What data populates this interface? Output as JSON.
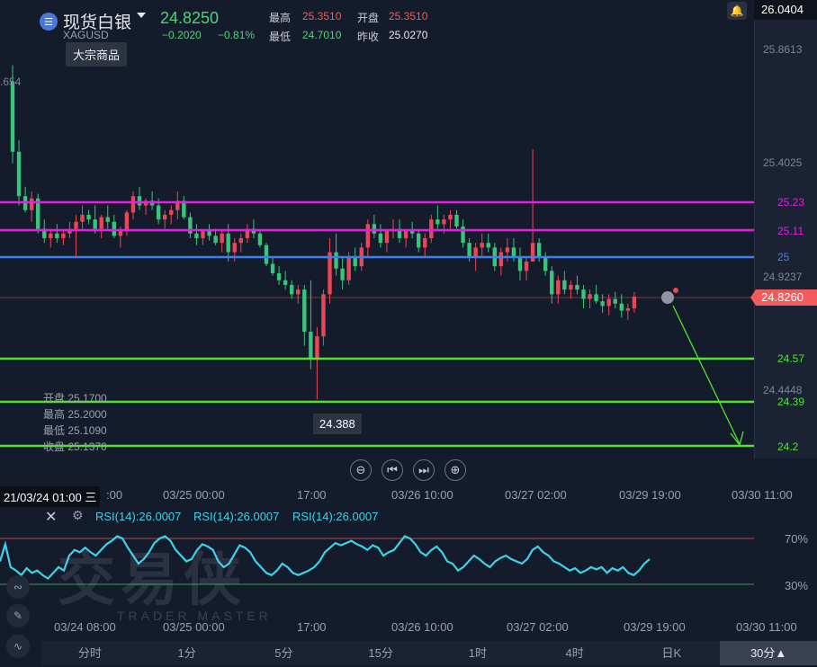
{
  "header": {
    "name": "现货白银",
    "code": "XAGUSD",
    "price": "24.8250",
    "change": "−0.2020",
    "change_pct": "−0.81%",
    "high_label": "最高",
    "high": "25.3510",
    "open_label": "开盘",
    "open": "25.3510",
    "low_label": "最低",
    "low": "24.7010",
    "prev_label": "昨收",
    "prev_close": "25.0270",
    "tooltip": "大宗商品",
    "left_clip": ".654"
  },
  "right_axis": {
    "top": "26.0404",
    "ticks": [
      "25.8613",
      "25.4025",
      "24.9237",
      "24.4448"
    ],
    "current": "24.8260"
  },
  "levels": [
    {
      "label": "25.23",
      "color": "#e61ee6"
    },
    {
      "label": "25.11",
      "color": "#e61ee6"
    },
    {
      "label": "25",
      "color": "#3c7ff0"
    },
    {
      "label": "24.57",
      "color": "#4ee62e"
    },
    {
      "label": "24.39",
      "color": "#4ee62e"
    },
    {
      "label": "24.2",
      "color": "#4ee62e"
    }
  ],
  "ohlc_box": {
    "open": "开盘 25.1700",
    "high": "最高 25.2000",
    "low": "最低 25.1090",
    "close": "收盘 25.1370"
  },
  "low_marker": "24.388",
  "controls": [
    "⊖",
    "⏮",
    "⏭",
    "⊕"
  ],
  "time_axis": {
    "cursor": "21/03/24 01:00 三",
    "labels": [
      "03/25 00:00",
      "17:00",
      "03/26 10:00",
      "03/27 02:00",
      "03/29 19:00",
      "03/30 11:00"
    ],
    "clip": ":00"
  },
  "rsi": {
    "labels": [
      "RSI(14):26.0007",
      "RSI(14):26.0007",
      "RSI(14):26.0007"
    ],
    "upper": "70%",
    "lower": "30%",
    "values": [
      50,
      65,
      45,
      42,
      38,
      44,
      40,
      42,
      38,
      35,
      40,
      45,
      42,
      55,
      60,
      58,
      62,
      58,
      55,
      60,
      65,
      68,
      72,
      70,
      62,
      55,
      48,
      52,
      58,
      66,
      70,
      72,
      68,
      60,
      55,
      50,
      52,
      60,
      65,
      63,
      60,
      50,
      45,
      48,
      56,
      64,
      62,
      58,
      50,
      45,
      40,
      38,
      42,
      48,
      45,
      40,
      38,
      40,
      42,
      45,
      50,
      58,
      62,
      66,
      64,
      66,
      68,
      65,
      63,
      60,
      64,
      62,
      55,
      58,
      60,
      66,
      72,
      70,
      65,
      58,
      55,
      60,
      63,
      58,
      50,
      48,
      42,
      45,
      50,
      55,
      52,
      48,
      45,
      50,
      53,
      55,
      52,
      50,
      48,
      52,
      60,
      63,
      58,
      55,
      50,
      48,
      45,
      42,
      44,
      40,
      42,
      45,
      43,
      45,
      40,
      44,
      42,
      45,
      40,
      38,
      42,
      48,
      52
    ],
    "time_labels": [
      "03/24 08:00",
      "03/25 00:00",
      "17:00",
      "03/26 10:00",
      "03/27 02:00",
      "03/29 19:00",
      "03/30 11:00"
    ]
  },
  "watermark": {
    "big": "交易侠",
    "small": "TRADER MASTER"
  },
  "tabs": [
    {
      "label": "分时",
      "active": false
    },
    {
      "label": "1分",
      "active": false
    },
    {
      "label": "5分",
      "active": false
    },
    {
      "label": "15分",
      "active": false
    },
    {
      "label": "1时",
      "active": false
    },
    {
      "label": "4时",
      "active": false
    },
    {
      "label": "日K",
      "active": false
    },
    {
      "label": "30分▲",
      "active": true
    }
  ],
  "candles": [
    [
      25.75,
      25.82,
      25.4,
      25.45
    ],
    [
      25.45,
      25.5,
      25.22,
      25.26
    ],
    [
      25.26,
      25.3,
      25.19,
      25.2
    ],
    [
      25.2,
      25.28,
      25.15,
      25.25
    ],
    [
      25.25,
      25.27,
      25.1,
      25.12
    ],
    [
      25.12,
      25.16,
      25.06,
      25.08
    ],
    [
      25.08,
      25.12,
      25.04,
      25.1
    ],
    [
      25.1,
      25.14,
      25.06,
      25.08
    ],
    [
      25.08,
      25.12,
      25.05,
      25.1
    ],
    [
      25.1,
      25.15,
      25.08,
      25.12
    ],
    [
      25.12,
      25.18,
      25.0,
      25.15
    ],
    [
      25.15,
      25.22,
      25.12,
      25.18
    ],
    [
      25.18,
      25.2,
      25.14,
      25.16
    ],
    [
      25.16,
      25.22,
      25.1,
      25.12
    ],
    [
      25.12,
      25.18,
      25.08,
      25.17
    ],
    [
      25.17,
      25.22,
      25.12,
      25.15
    ],
    [
      25.15,
      25.18,
      25.08,
      25.09
    ],
    [
      25.09,
      25.13,
      25.04,
      25.11
    ],
    [
      25.11,
      25.2,
      25.09,
      25.19
    ],
    [
      25.19,
      25.28,
      25.16,
      25.26
    ],
    [
      25.26,
      25.3,
      25.2,
      25.22
    ],
    [
      25.22,
      25.25,
      25.18,
      25.24
    ],
    [
      25.24,
      25.28,
      25.2,
      25.22
    ],
    [
      25.22,
      25.25,
      25.14,
      25.16
    ],
    [
      25.16,
      25.2,
      25.12,
      25.18
    ],
    [
      25.18,
      25.22,
      25.14,
      25.2
    ],
    [
      25.2,
      25.28,
      25.16,
      25.24
    ],
    [
      25.24,
      25.26,
      25.16,
      25.17
    ],
    [
      25.17,
      25.19,
      25.08,
      25.1
    ],
    [
      25.1,
      25.14,
      25.05,
      25.08
    ],
    [
      25.08,
      25.12,
      25.05,
      25.11
    ],
    [
      25.11,
      25.14,
      25.07,
      25.09
    ],
    [
      25.09,
      25.12,
      25.05,
      25.06
    ],
    [
      25.06,
      25.12,
      25.02,
      25.1
    ],
    [
      25.1,
      25.14,
      24.98,
      25.02
    ],
    [
      25.02,
      25.08,
      24.98,
      25.06
    ],
    [
      25.06,
      25.1,
      25.02,
      25.08
    ],
    [
      25.08,
      25.14,
      25.06,
      25.12
    ],
    [
      25.12,
      25.16,
      25.08,
      25.1
    ],
    [
      25.1,
      25.12,
      25.04,
      25.05
    ],
    [
      25.05,
      25.06,
      24.96,
      24.97
    ],
    [
      24.97,
      25.0,
      24.92,
      24.93
    ],
    [
      24.93,
      24.96,
      24.88,
      24.9
    ],
    [
      24.9,
      24.94,
      24.86,
      24.88
    ],
    [
      24.88,
      24.9,
      24.82,
      24.84
    ],
    [
      24.84,
      24.88,
      24.8,
      24.86
    ],
    [
      24.86,
      24.88,
      24.62,
      24.68
    ],
    [
      24.68,
      24.9,
      24.52,
      24.56
    ],
    [
      24.56,
      24.7,
      24.39,
      24.66
    ],
    [
      24.66,
      24.86,
      24.62,
      24.84
    ],
    [
      24.84,
      25.08,
      24.8,
      25.02
    ],
    [
      25.02,
      25.1,
      24.92,
      24.95
    ],
    [
      24.95,
      25.0,
      24.86,
      24.9
    ],
    [
      24.9,
      25.02,
      24.88,
      25.0
    ],
    [
      25.0,
      25.04,
      24.94,
      24.96
    ],
    [
      24.96,
      25.06,
      24.94,
      25.04
    ],
    [
      25.04,
      25.16,
      25.0,
      25.14
    ],
    [
      25.14,
      25.18,
      25.08,
      25.1
    ],
    [
      25.1,
      25.14,
      25.04,
      25.06
    ],
    [
      25.06,
      25.12,
      25.02,
      25.11
    ],
    [
      25.11,
      25.16,
      25.08,
      25.12
    ],
    [
      25.12,
      25.16,
      25.06,
      25.08
    ],
    [
      25.08,
      25.12,
      25.04,
      25.11
    ],
    [
      25.11,
      25.15,
      25.08,
      25.1
    ],
    [
      25.1,
      25.12,
      25.02,
      25.04
    ],
    [
      25.04,
      25.1,
      25.0,
      25.08
    ],
    [
      25.08,
      25.18,
      25.06,
      25.16
    ],
    [
      25.16,
      25.22,
      25.12,
      25.14
    ],
    [
      25.14,
      25.18,
      25.1,
      25.16
    ],
    [
      25.16,
      25.2,
      25.12,
      25.18
    ],
    [
      25.18,
      25.2,
      25.12,
      25.13
    ],
    [
      25.13,
      25.16,
      25.04,
      25.06
    ],
    [
      25.06,
      25.08,
      24.98,
      25.0
    ],
    [
      25.0,
      25.06,
      24.94,
      25.04
    ],
    [
      25.04,
      25.1,
      25.0,
      25.06
    ],
    [
      25.06,
      25.1,
      25.02,
      25.04
    ],
    [
      25.04,
      25.06,
      24.94,
      24.96
    ],
    [
      24.96,
      25.04,
      24.92,
      25.02
    ],
    [
      25.02,
      25.08,
      24.98,
      25.04
    ],
    [
      25.04,
      25.08,
      24.98,
      25.0
    ],
    [
      25.0,
      25.04,
      24.9,
      24.94
    ],
    [
      24.94,
      25.0,
      24.9,
      24.98
    ],
    [
      24.98,
      25.46,
      24.98,
      25.06
    ],
    [
      25.06,
      25.08,
      24.98,
      25.0
    ],
    [
      25.0,
      25.02,
      24.92,
      24.94
    ],
    [
      24.94,
      24.96,
      24.8,
      24.84
    ],
    [
      24.84,
      24.92,
      24.8,
      24.9
    ],
    [
      24.9,
      24.94,
      24.84,
      24.86
    ],
    [
      24.86,
      24.9,
      24.82,
      24.88
    ],
    [
      24.88,
      24.92,
      24.84,
      24.86
    ],
    [
      24.86,
      24.88,
      24.78,
      24.82
    ],
    [
      24.82,
      24.86,
      24.78,
      24.84
    ],
    [
      24.84,
      24.88,
      24.8,
      24.81
    ],
    [
      24.81,
      24.84,
      24.76,
      24.79
    ],
    [
      24.79,
      24.84,
      24.75,
      24.82
    ],
    [
      24.82,
      24.85,
      24.78,
      24.8
    ],
    [
      24.8,
      24.84,
      24.74,
      24.77
    ],
    [
      24.77,
      24.8,
      24.73,
      24.78
    ],
    [
      24.78,
      24.85,
      24.76,
      24.83
    ]
  ]
}
